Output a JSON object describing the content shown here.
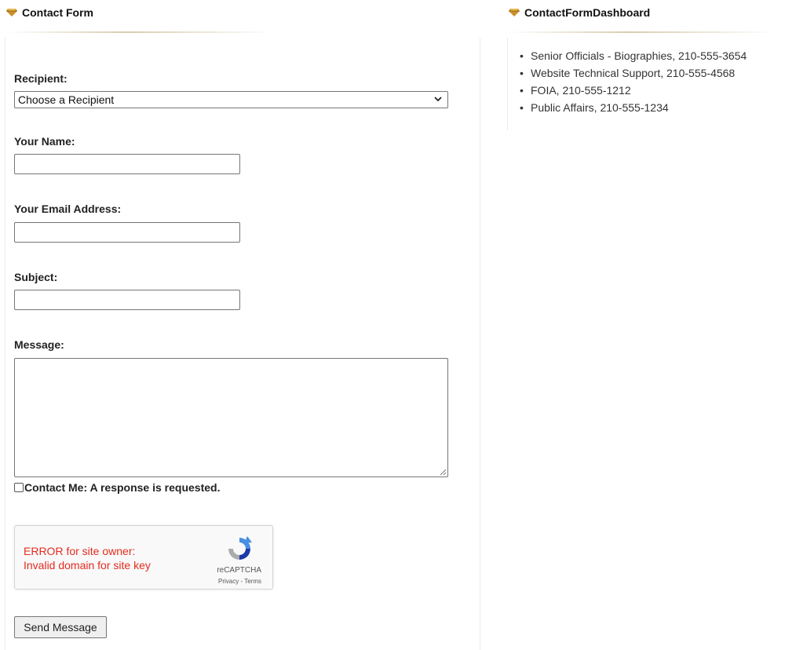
{
  "left_panel": {
    "title": "Contact Form",
    "recipient_label": "Recipient:",
    "recipient_selected": "Choose a Recipient",
    "name_label": "Your Name:",
    "name_value": "",
    "email_label": "Your Email Address:",
    "email_value": "",
    "subject_label": "Subject:",
    "subject_value": "",
    "message_label": "Message:",
    "message_value": "",
    "contact_me_label": "Contact Me: A response is requested.",
    "contact_me_checked": false,
    "captcha": {
      "error_line1": "ERROR for site owner:",
      "error_line2": "Invalid domain for site key",
      "brand": "reCAPTCHA",
      "links": "Privacy - Terms"
    },
    "send_label": "Send Message"
  },
  "right_panel": {
    "title": "ContactFormDashboard",
    "items": [
      "Senior Officials - Biographies, 210-555-3654",
      "Website Technical Support, 210-555-4568",
      "FOIA, 210-555-1212",
      "Public Affairs, 210-555-1234"
    ]
  },
  "colors": {
    "accent_gem": "#c9902a",
    "error_text": "#e42b1f",
    "rule": "#d8ccb0"
  },
  "icons": {
    "header": "gem-icon",
    "select": "chevron-down-icon",
    "captcha": "recaptcha-logo-icon"
  }
}
